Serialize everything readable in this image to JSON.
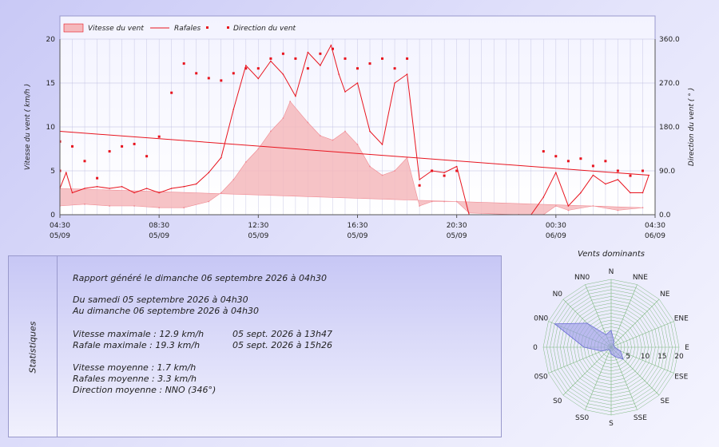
{
  "colors": {
    "speed_fill": "#f5b8bc",
    "gust_line": "#e8141e",
    "direction_dot": "#e8141e",
    "grid": "#bcbce0",
    "plot_bg": "#f8f8ff",
    "rose_fill": "#9a9ae6",
    "rose_grid": "#7fb87f"
  },
  "chart_data": {
    "type": "line",
    "legend": {
      "position": "top-left",
      "items": [
        "Vitesse du vent",
        "Rafales",
        "Direction du vent"
      ]
    },
    "ylabel_left": "Vitesse du vent ( km/h )",
    "ylabel_right": "Direction du vent ( ° )",
    "ylim_left": [
      0,
      20
    ],
    "ylim_right": [
      0,
      360
    ],
    "yticks_left": [
      "0",
      "5",
      "10",
      "15",
      "20"
    ],
    "yticks_right": [
      "0.0",
      "90.0",
      "180.0",
      "270.0",
      "360.0"
    ],
    "xticks": [
      {
        "time": "04:30",
        "date": "05/09"
      },
      {
        "time": "08:30",
        "date": "05/09"
      },
      {
        "time": "12:30",
        "date": "05/09"
      },
      {
        "time": "16:30",
        "date": "05/09"
      },
      {
        "time": "20:30",
        "date": "05/09"
      },
      {
        "time": "00:30",
        "date": "06/09"
      },
      {
        "time": "04:30",
        "date": "06/09"
      }
    ],
    "grid": true,
    "series": [
      {
        "name": "Vitesse du vent",
        "x": [
          "04:30",
          "05:30",
          "06:30",
          "07:30",
          "08:30",
          "09:30",
          "10:30",
          "11:00",
          "11:30",
          "12:00",
          "12:30",
          "13:00",
          "13:30",
          "13:47",
          "14:30",
          "15:00",
          "15:30",
          "16:00",
          "16:30",
          "17:00",
          "17:30",
          "18:00",
          "18:30",
          "19:00",
          "19:30",
          "20:00",
          "20:30",
          "21:00",
          "23:00",
          "00:00",
          "00:30",
          "01:00",
          "02:00",
          "03:00",
          "04:00",
          "04:30"
        ],
        "values": [
          1.0,
          1.2,
          1.0,
          1.0,
          0.8,
          0.8,
          1.5,
          2.5,
          4.0,
          6.0,
          7.5,
          9.5,
          11.0,
          12.9,
          10.5,
          9.0,
          8.5,
          9.5,
          8.0,
          5.5,
          4.5,
          5.0,
          6.5,
          1.0,
          1.5,
          1.5,
          1.5,
          0.2,
          0.0,
          0.0,
          1.0,
          0.5,
          1.0,
          0.5,
          0.8,
          3.0
        ]
      },
      {
        "name": "Rafales",
        "x": [
          "04:30",
          "04:45",
          "05:00",
          "05:30",
          "06:00",
          "06:30",
          "07:00",
          "07:30",
          "08:00",
          "08:30",
          "09:00",
          "09:30",
          "10:00",
          "10:30",
          "11:00",
          "11:30",
          "12:00",
          "12:30",
          "13:00",
          "13:30",
          "14:00",
          "14:30",
          "15:00",
          "15:26",
          "15:45",
          "16:00",
          "16:30",
          "17:00",
          "17:30",
          "18:00",
          "18:30",
          "19:00",
          "19:30",
          "20:00",
          "20:30",
          "21:00",
          "23:00",
          "23:30",
          "00:00",
          "00:30",
          "01:00",
          "01:30",
          "02:00",
          "02:30",
          "03:00",
          "03:30",
          "04:00",
          "04:15",
          "04:30"
        ],
        "values": [
          3.0,
          4.8,
          2.5,
          3.0,
          3.2,
          3.0,
          3.2,
          2.5,
          3.0,
          2.5,
          3.0,
          3.2,
          3.5,
          4.8,
          6.5,
          12.0,
          17.0,
          15.5,
          17.5,
          16.0,
          13.5,
          18.5,
          17.0,
          19.3,
          16.0,
          14.0,
          15.0,
          9.5,
          8.0,
          15.0,
          16.0,
          4.0,
          5.0,
          4.8,
          5.5,
          0.0,
          0.0,
          0.0,
          2.0,
          4.8,
          1.0,
          2.5,
          4.5,
          3.5,
          4.0,
          2.5,
          2.5,
          4.5,
          9.5
        ]
      },
      {
        "name": "Direction du vent",
        "x": [
          "04:30",
          "05:00",
          "05:30",
          "06:00",
          "06:30",
          "07:00",
          "07:30",
          "08:00",
          "08:30",
          "09:00",
          "09:30",
          "10:00",
          "10:30",
          "11:00",
          "11:30",
          "12:00",
          "12:30",
          "13:00",
          "13:30",
          "14:00",
          "14:30",
          "15:00",
          "15:30",
          "16:00",
          "16:30",
          "17:00",
          "17:30",
          "18:00",
          "18:30",
          "19:00",
          "19:30",
          "20:00",
          "20:30",
          "00:00",
          "00:30",
          "01:00",
          "01:30",
          "02:00",
          "02:30",
          "03:00",
          "03:30",
          "04:00",
          "04:30"
        ],
        "values": [
          150,
          140,
          110,
          75,
          130,
          140,
          145,
          120,
          160,
          250,
          310,
          290,
          280,
          275,
          290,
          300,
          300,
          320,
          330,
          320,
          300,
          330,
          340,
          320,
          300,
          310,
          320,
          300,
          320,
          60,
          90,
          80,
          90,
          130,
          120,
          110,
          115,
          100,
          110,
          90,
          80,
          90,
          90
        ]
      }
    ]
  },
  "stats": {
    "side_label": "Statistiques",
    "report_line": "Rapport généré le dimanche 06 septembre 2026 à 04h30",
    "period_from": "Du samedi 05 septembre 2026 à 04h30",
    "period_to": "Au dimanche 06 septembre 2026 à 04h30",
    "max_speed_label": "Vitesse maximale : 12.9 km/h",
    "max_speed_date": "05 sept. 2026 à 13h47",
    "max_gust_label": "Rafale maximale : 19.3 km/h",
    "max_gust_date": "05 sept. 2026 à 15h26",
    "avg_speed": "Vitesse moyenne : 1.7 km/h",
    "avg_gust": "Rafales moyenne : 3.3 km/h",
    "avg_direction": "Direction moyenne : NNO (346°)"
  },
  "rose": {
    "title": "Vents dominants",
    "directions": [
      "N",
      "NNE",
      "NE",
      "ENE",
      "E",
      "ESE",
      "SE",
      "SSE",
      "S",
      "SS0",
      "S0",
      "0S0",
      "0",
      "0N0",
      "N0",
      "NN0"
    ],
    "values": [
      5,
      2,
      1,
      1,
      1,
      3,
      5,
      3,
      2,
      1,
      1,
      3,
      8,
      18,
      10,
      4
    ],
    "rings": [
      5,
      10,
      15,
      20
    ],
    "ring_labels": [
      "5",
      "10",
      "15",
      "20"
    ]
  }
}
